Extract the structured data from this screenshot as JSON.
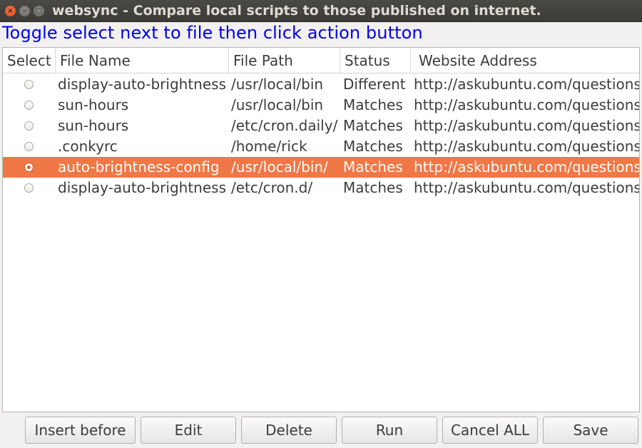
{
  "window": {
    "title": "websync - Compare local scripts to those published on internet.",
    "close_glyph": "×",
    "min_glyph": "–",
    "max_glyph": "□"
  },
  "instruction": "Toggle select next to file then click action button",
  "table": {
    "columns": [
      "Select",
      "File Name",
      "File Path",
      "Status",
      "Website Address"
    ],
    "rows": [
      {
        "selected": false,
        "file_name": "display-auto-brightness",
        "file_path": "/usr/local/bin",
        "status": "Different",
        "website": "http://askubuntu.com/questions"
      },
      {
        "selected": false,
        "file_name": "sun-hours",
        "file_path": "/usr/local/bin",
        "status": "Matches",
        "website": "http://askubuntu.com/questions"
      },
      {
        "selected": false,
        "file_name": "sun-hours",
        "file_path": "/etc/cron.daily/",
        "status": "Matches",
        "website": "http://askubuntu.com/questions"
      },
      {
        "selected": false,
        "file_name": ".conkyrc",
        "file_path": "/home/rick",
        "status": "Matches",
        "website": "http://askubuntu.com/questions"
      },
      {
        "selected": true,
        "file_name": "auto-brightness-config",
        "file_path": "/usr/local/bin/",
        "status": "Matches",
        "website": "http://askubuntu.com/questions"
      },
      {
        "selected": false,
        "file_name": "display-auto-brightness",
        "file_path": "/etc/cron.d/",
        "status": "Matches",
        "website": "http://askubuntu.com/questions"
      }
    ]
  },
  "buttons": {
    "insert_before": "Insert before",
    "edit": "Edit",
    "delete": "Delete",
    "run": "Run",
    "cancel_all": "Cancel ALL",
    "save": "Save"
  },
  "colors": {
    "selection": "#f07746",
    "instruction_text": "#0000ee",
    "close_button": "#dd4814"
  }
}
